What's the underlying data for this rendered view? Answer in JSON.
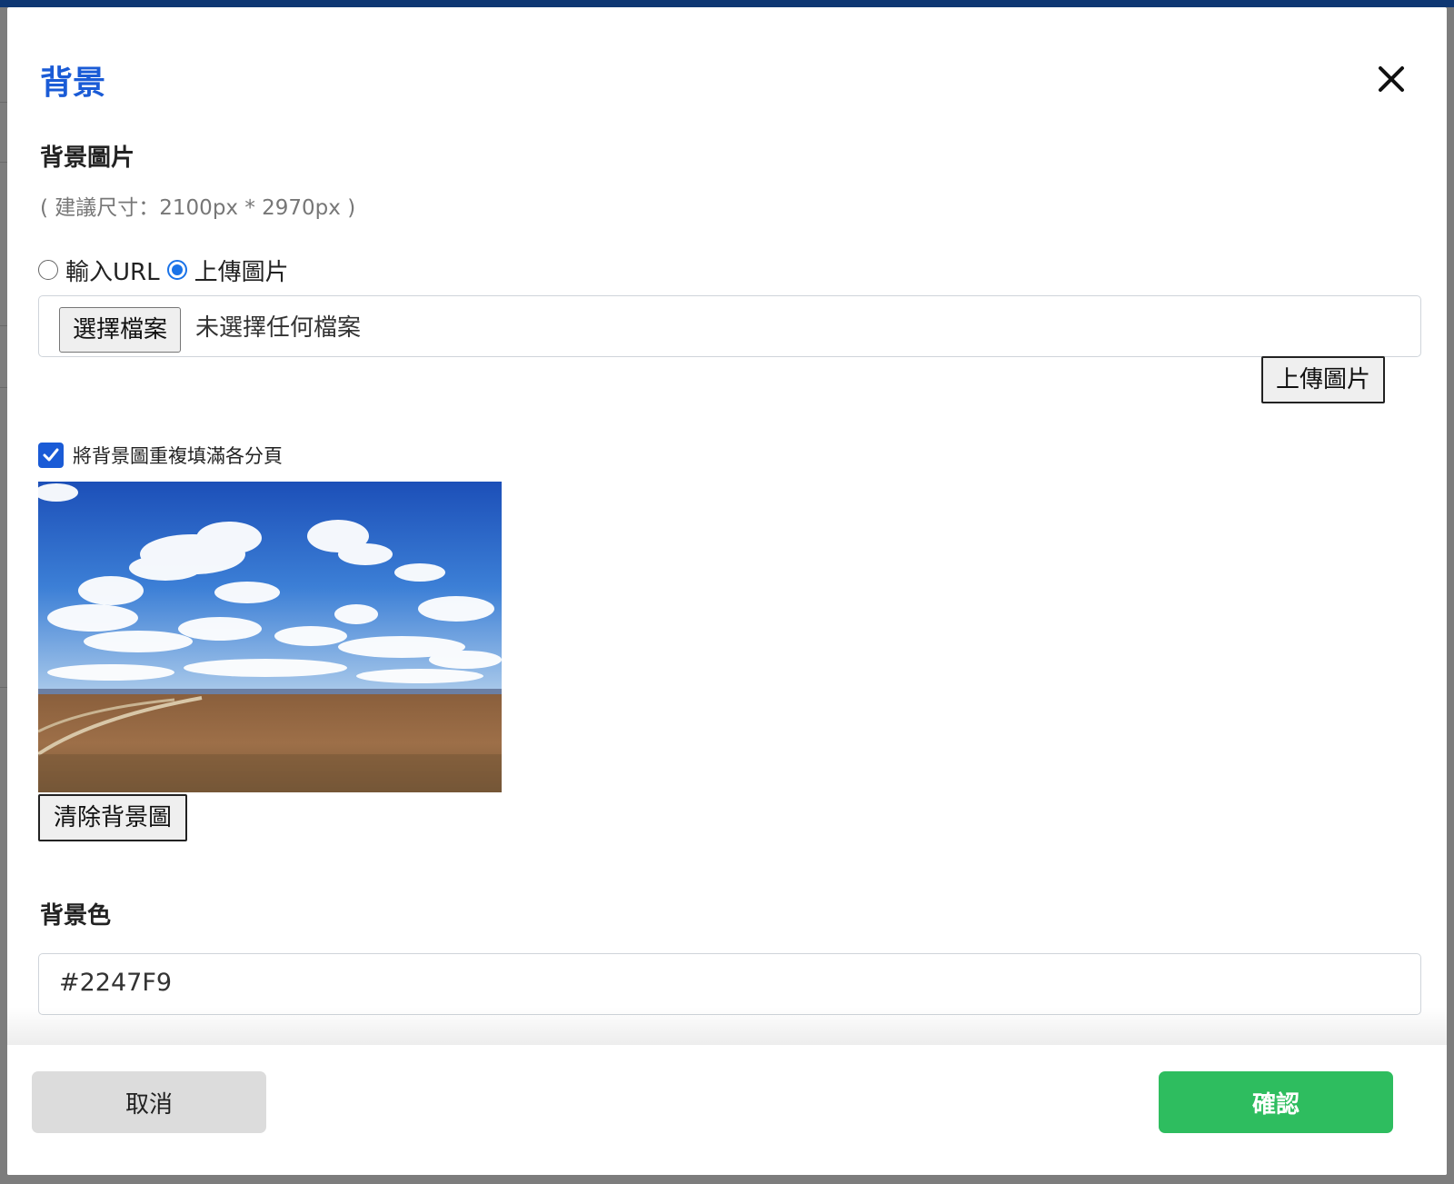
{
  "modal": {
    "title": "背景",
    "close_icon": "close-icon"
  },
  "background_image": {
    "label": "背景圖片",
    "hint": "( 建議尺寸：2100px * 2970px )",
    "source_options": [
      {
        "label": "輸入URL",
        "selected": false
      },
      {
        "label": "上傳圖片",
        "selected": true
      }
    ],
    "file_picker": {
      "button_label": "選擇檔案",
      "status_text": "未選擇任何檔案"
    },
    "upload_button_label": "上傳圖片",
    "repeat_checkbox": {
      "label": "將背景圖重複填滿各分頁",
      "checked": true
    },
    "clear_button_label": "清除背景圖"
  },
  "background_color": {
    "label": "背景色",
    "value": "#2247F9"
  },
  "footer": {
    "cancel_label": "取消",
    "confirm_label": "確認"
  },
  "colors": {
    "title": "#1a5bd6",
    "confirm": "#2ebd5f",
    "cancel": "#dcdcdc",
    "top_bar": "#0e3773"
  }
}
